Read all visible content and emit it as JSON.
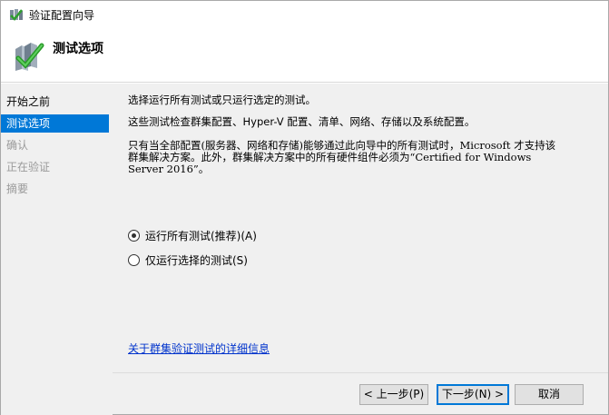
{
  "window": {
    "title": "验证配置向导"
  },
  "header": {
    "page_title": "测试选项"
  },
  "steps": [
    {
      "label": "开始之前",
      "state": "done"
    },
    {
      "label": "测试选项",
      "state": "active"
    },
    {
      "label": "确认",
      "state": "pending"
    },
    {
      "label": "正在验证",
      "state": "pending"
    },
    {
      "label": "摘要",
      "state": "pending"
    }
  ],
  "content": {
    "intro": "选择运行所有测试或只运行选定的测试。",
    "checks": "这些测试检查群集配置、Hyper-V 配置、清单、网络、存储以及系统配置。",
    "support_line1": "只有当全部配置(服务器、网络和存储)能够通过此向导中的所有测试时，Microsoft 才支持该",
    "support_line2": "群集解决方案。此外，群集解决方案中的所有硬件组件必须为“Certified for Windows",
    "support_line3": "Server 2016”。",
    "options": [
      {
        "label": "运行所有测试(推荐)(A)",
        "checked": true
      },
      {
        "label": "仅运行选择的测试(S)",
        "checked": false
      }
    ],
    "info_link": "关于群集验证测试的详细信息"
  },
  "buttons": {
    "back": "< 上一步(P)",
    "next": "下一步(N) >",
    "cancel": "取消"
  },
  "colors": {
    "accent": "#0078d7",
    "link": "#0033cc",
    "panel": "#f0f0f0"
  }
}
